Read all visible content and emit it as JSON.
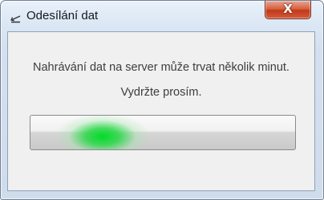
{
  "window": {
    "title": "Odesílání dat",
    "title_icon": "upload-arrow-icon",
    "close_label": "X"
  },
  "dialog": {
    "message_line1": "Nahrávání dat na server může trvat několik minut.",
    "message_line2": "Vydržte prosím."
  },
  "progress": {
    "mode": "indeterminate",
    "fill_color": "#00d828"
  },
  "colors": {
    "close_button": "#c9421f",
    "titlebar": "#dbe7f4",
    "content_bg": "#f0f0f0"
  }
}
